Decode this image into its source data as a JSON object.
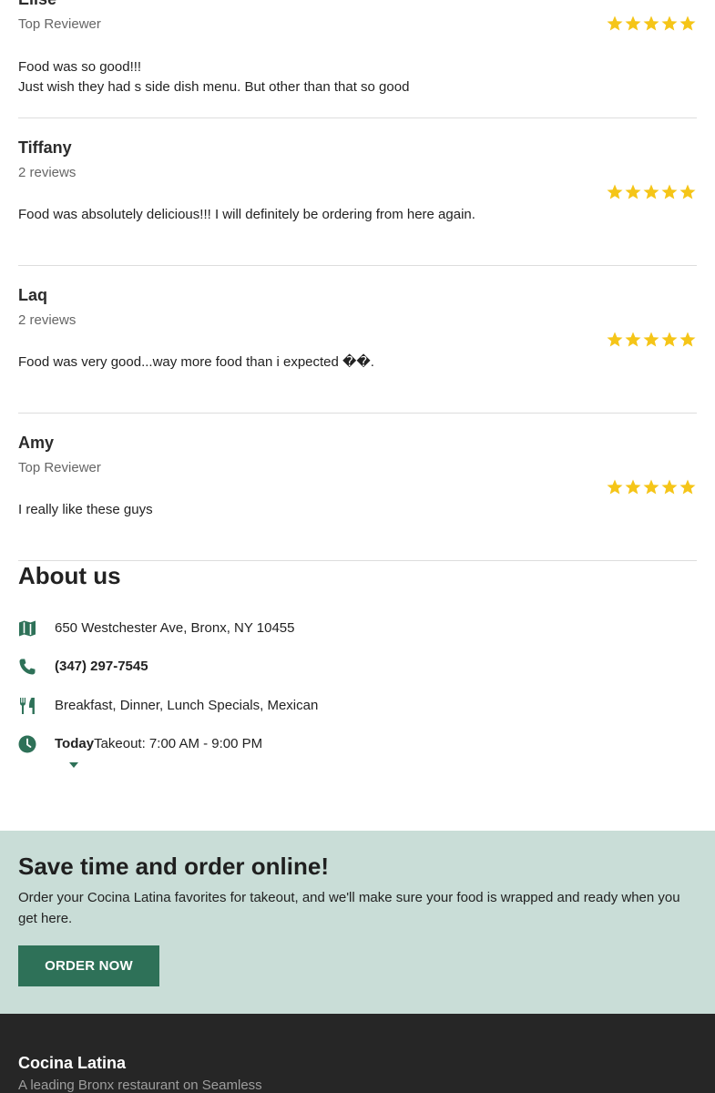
{
  "reviews": [
    {
      "name": "Elise",
      "meta": "Top Reviewer",
      "rating": 5,
      "body_lines": [
        "Food was so good!!!",
        "Just wish they had s side dish menu. But other than that so good"
      ]
    },
    {
      "name": "Tiffany",
      "meta": "2 reviews",
      "rating": 5,
      "body_lines": [
        "Food was absolutely delicious!!! I will definitely be ordering from here again."
      ]
    },
    {
      "name": "Laq",
      "meta": "2 reviews",
      "rating": 5,
      "body_lines": [
        "Food was very good...way more food than i expected ��."
      ]
    },
    {
      "name": "Amy",
      "meta": "Top Reviewer",
      "rating": 5,
      "body_lines": [
        "I really like these guys"
      ]
    }
  ],
  "about": {
    "title": "About us",
    "address": "650 Westchester Ave, Bronx, NY 10455",
    "phone": "(347) 297-7545",
    "cuisines": "Breakfast, Dinner, Lunch Specials, Mexican",
    "hours_day": "Today",
    "hours_text": "Takeout: 7:00 AM - 9:00 PM",
    "icons": [
      "map-icon",
      "phone-icon",
      "utensils-icon",
      "clock-icon",
      "caret-down-icon"
    ]
  },
  "promo": {
    "title": "Save time and order online!",
    "text": "Order your Cocina Latina favorites for takeout, and we'll make sure your food is wrapped and ready when you get here.",
    "button_label": "ORDER NOW"
  },
  "footer": {
    "brand": "Cocina Latina",
    "tagline": "A leading Bronx restaurant on Seamless"
  },
  "colors": {
    "star": "#f5c518",
    "accent": "#2e7158",
    "promo_bg": "#c9ddd7",
    "footer_bg": "#262626"
  }
}
